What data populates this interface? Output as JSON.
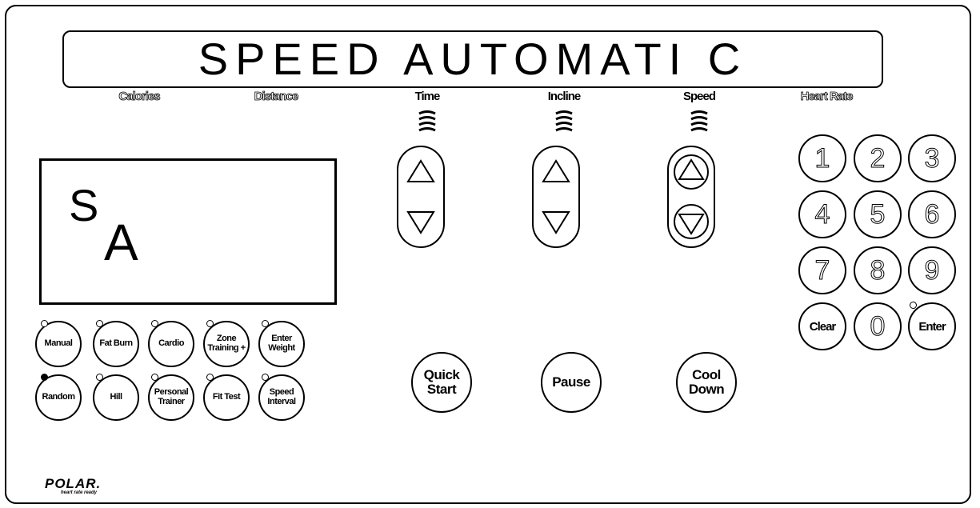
{
  "display": {
    "text": "SPEED AUTOMATI C"
  },
  "labels": {
    "calories": "Calories",
    "distance": "Distance",
    "time": "Time",
    "incline": "Incline",
    "speed": "Speed",
    "heart_rate": "Heart Rate"
  },
  "program_display": {
    "top_char": "S",
    "bottom_char": "A"
  },
  "programs": {
    "manual": "Manual",
    "fat_burn": "Fat Burn",
    "cardio": "Cardio",
    "zone_training": "Zone Training +",
    "enter_weight": "Enter Weight",
    "random": "Random",
    "hill": "Hill",
    "personal_trainer": "Personal Trainer",
    "fit_test": "Fit Test",
    "speed_interval": "Speed Interval"
  },
  "controls": {
    "quick_start": "Quick Start",
    "pause": "Pause",
    "cool_down": "Cool Down"
  },
  "keypad": {
    "k1": "1",
    "k2": "2",
    "k3": "3",
    "k4": "4",
    "k5": "5",
    "k6": "6",
    "k7": "7",
    "k8": "8",
    "k9": "9",
    "clear": "Clear",
    "k0": "0",
    "enter": "Enter"
  },
  "logo": {
    "main": "POLAR.",
    "sub": "heart rate ready"
  },
  "icons": {
    "arrow_up": "triangle-up-icon",
    "arrow_down": "triangle-down-icon",
    "signal": "signal-waves-icon"
  },
  "colors": {
    "line": "#000000",
    "background": "#ffffff",
    "led_active": "#000000"
  }
}
